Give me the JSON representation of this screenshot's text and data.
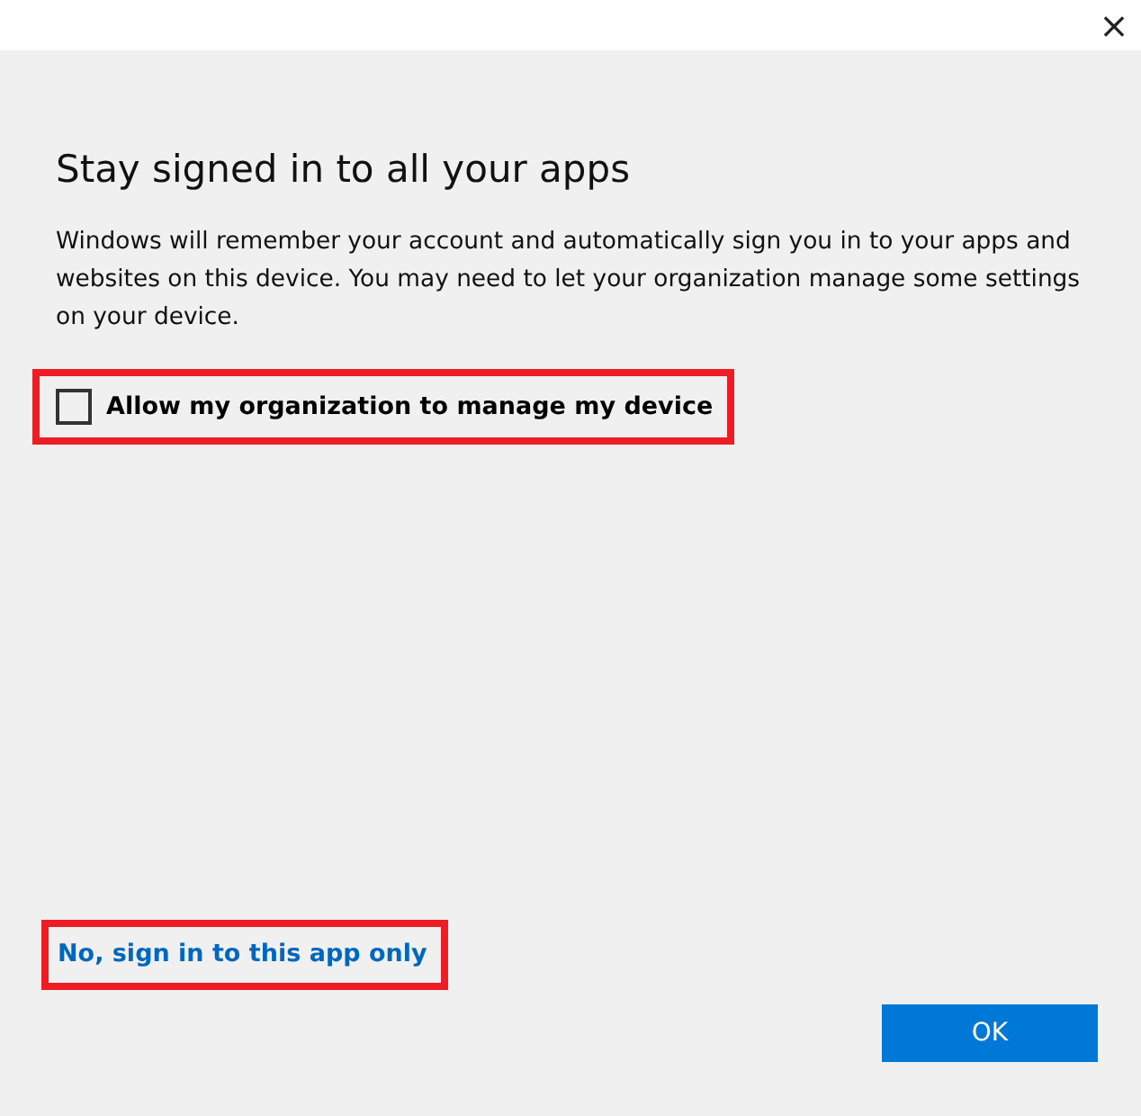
{
  "window": {
    "close_icon": "×"
  },
  "title": "Stay signed in to all your apps",
  "description": "Windows will remember your account and automatically sign you in to your apps and websites on this device. You may need to let your organization manage some settings on your device.",
  "checkbox": {
    "label": "Allow my organization to manage my device",
    "checked": false,
    "highlighted": true
  },
  "link": {
    "label": "No, sign in to this app only",
    "highlighted": true
  },
  "buttons": [
    "OK"
  ]
}
